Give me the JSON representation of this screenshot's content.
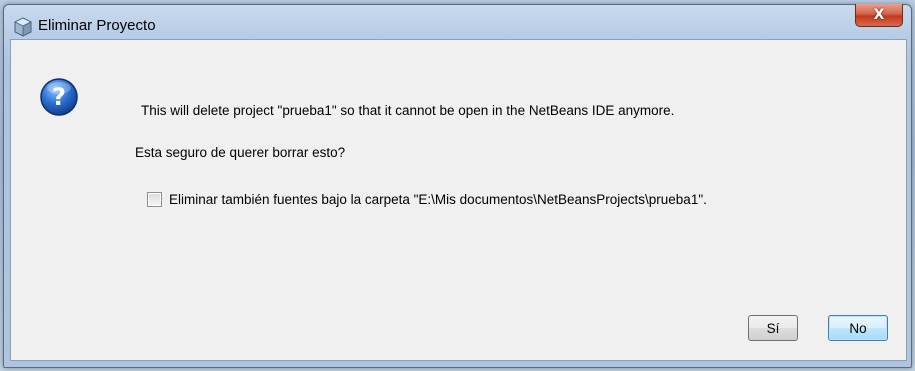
{
  "window": {
    "title": "Eliminar Proyecto",
    "close_symbol": "X",
    "title_icon": "netbeans-cube-icon"
  },
  "dialog": {
    "icon": "question-icon",
    "message": "This will delete project \"prueba1\" so that it cannot be open in the NetBeans IDE anymore.",
    "question": "Esta seguro de querer borrar esto?",
    "checkbox": {
      "label": "Eliminar también fuentes bajo la carpeta \"E:\\Mis documentos\\NetBeansProjects\\prueba1\".",
      "checked": false
    },
    "buttons": {
      "yes": "Sí",
      "no": "No"
    }
  },
  "colors": {
    "close_button": "#c2391c",
    "default_button_border": "#3c7fb1",
    "question_icon": "#1f5fb5"
  }
}
